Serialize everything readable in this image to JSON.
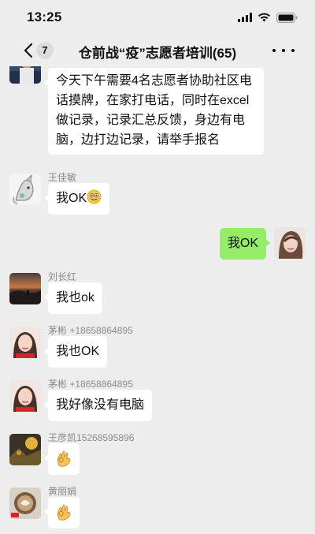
{
  "status_bar": {
    "time": "13:25"
  },
  "nav": {
    "back_count": "7",
    "title": "仓前战“疫”志愿者培训(65)"
  },
  "messages": [
    {
      "sender": "",
      "text": "今天下午需要4名志愿者协助社区电话摸牌，在家打电话，同时在excel做记录，记录汇总反馈，身边有电脑，边打边记录，请举手报名"
    },
    {
      "sender": "王佳敏",
      "text": "我OK",
      "emoji": "smiling-face-emoji"
    },
    {
      "sender": "",
      "text": "我OK",
      "mine": true
    },
    {
      "sender": "刘长红",
      "text": "我也ok"
    },
    {
      "sender": "茅彬 +18658864895",
      "text": "我也OK"
    },
    {
      "sender": "茅彬 +18658864895",
      "text": "我好像没有电脑"
    },
    {
      "sender": "王彦凯15268595896",
      "text": "",
      "emoji": "ok-hand-emoji"
    },
    {
      "sender": "黄丽娟",
      "text": "",
      "emoji": "ok-hand-emoji"
    }
  ],
  "colors": {
    "background": "#ededed",
    "my_bubble": "#95ec69",
    "other_bubble": "#ffffff",
    "sender_name": "#8a8a8a"
  },
  "icons": [
    "signal-icon",
    "wifi-icon",
    "battery-icon",
    "back-chevron-icon",
    "more-dots-icon"
  ]
}
